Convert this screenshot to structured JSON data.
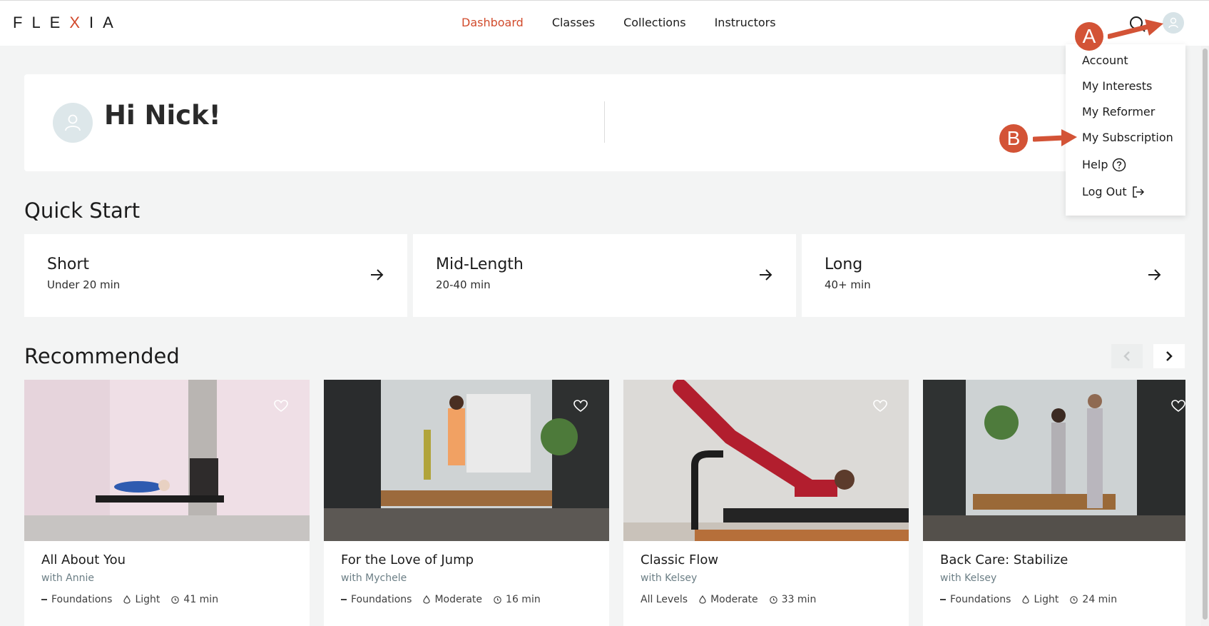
{
  "brand": {
    "logo_left": "FLE",
    "logo_x": "X",
    "logo_right": "IA",
    "accent": "#d14b2c"
  },
  "nav": {
    "items": [
      {
        "label": "Dashboard",
        "active": true
      },
      {
        "label": "Classes",
        "active": false
      },
      {
        "label": "Collections",
        "active": false
      },
      {
        "label": "Instructors",
        "active": false
      }
    ]
  },
  "user_menu": {
    "items": [
      {
        "label": "Account"
      },
      {
        "label": "My Interests"
      },
      {
        "label": "My Reformer"
      },
      {
        "label": "My Subscription"
      },
      {
        "label": "Help",
        "icon": "help-circle-icon"
      },
      {
        "label": "Log Out",
        "icon": "logout-icon"
      }
    ]
  },
  "greeting": {
    "text": "Hi Nick!"
  },
  "quick_start": {
    "title": "Quick Start",
    "cards": [
      {
        "title": "Short",
        "subtitle": "Under 20 min"
      },
      {
        "title": "Mid-Length",
        "subtitle": "20-40 min"
      },
      {
        "title": "Long",
        "subtitle": "40+ min"
      }
    ]
  },
  "recommended": {
    "title": "Recommended",
    "classes": [
      {
        "title": "All About You",
        "instructor": "with Annie",
        "level": "Foundations",
        "intensity": "Light",
        "duration": "41 min",
        "level_dash": true
      },
      {
        "title": "For the Love of Jump",
        "instructor": "with Mychele",
        "level": "Foundations",
        "intensity": "Moderate",
        "duration": "16 min",
        "level_dash": true
      },
      {
        "title": "Classic Flow",
        "instructor": "with Kelsey",
        "level": "All Levels",
        "intensity": "Moderate",
        "duration": "33 min",
        "level_dash": false
      },
      {
        "title": "Back Care: Stabilize",
        "instructor": "with Kelsey",
        "level": "Foundations",
        "intensity": "Light",
        "duration": "24 min",
        "level_dash": true
      }
    ]
  },
  "annotations": {
    "a": "A",
    "b": "B"
  }
}
